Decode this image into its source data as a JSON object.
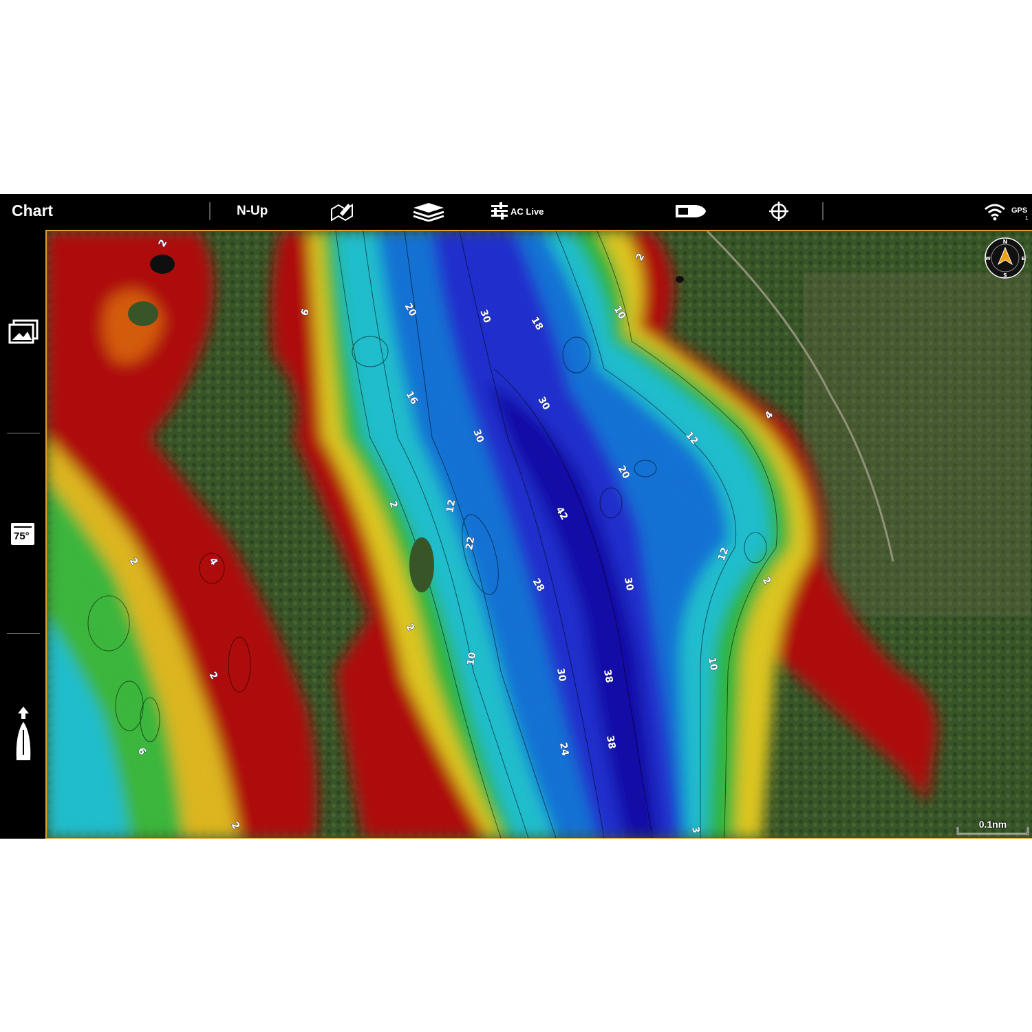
{
  "topbar": {
    "title": "Chart",
    "orientation": "N-Up",
    "icons": [
      "chart-edit-icon",
      "layers-icon",
      "settings-sliders-icon",
      "boat-icon",
      "crosshair-icon",
      "wifi-icon"
    ],
    "aclive_label": "AC Live",
    "gps_label": "GPS",
    "gps_sub": "1"
  },
  "sidebar": {
    "icons": [
      "image-gallery-icon",
      "temperature-icon",
      "boat-heading-icon"
    ],
    "temperature": "75°"
  },
  "map": {
    "depth_labels": [
      "2",
      "6",
      "20",
      "30",
      "18",
      "10",
      "2",
      "16",
      "30",
      "30",
      "12",
      "4",
      "20",
      "2",
      "42",
      "12",
      "22",
      "28",
      "30",
      "2",
      "12",
      "4",
      "2",
      "2",
      "10",
      "30",
      "38",
      "10",
      "2",
      "6",
      "24",
      "38",
      "2",
      "3",
      "2"
    ],
    "scale_label": "0.1nm",
    "compass": {
      "n": "N",
      "s": "S",
      "e": "E",
      "w": "W"
    },
    "colors": {
      "frame": "#e0a02a",
      "shallow": "#b01010",
      "mid": "#20c0d0",
      "deep": "#1010c0",
      "land": "#3d5a2c"
    }
  }
}
